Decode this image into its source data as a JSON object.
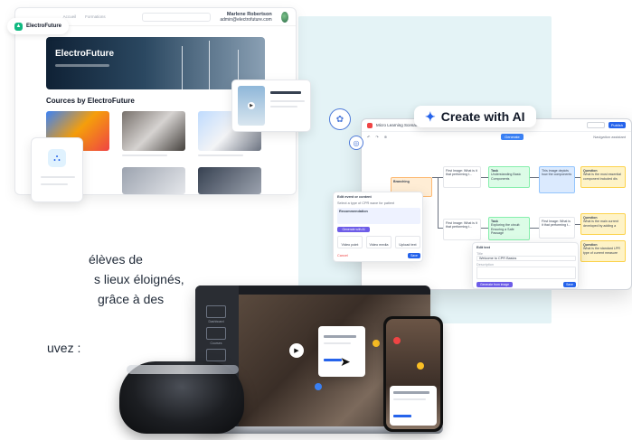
{
  "left_dashboard": {
    "brand": "ElectroFuture",
    "nav": [
      "Accueil",
      "Formations"
    ],
    "user_name": "Marlene Robertson",
    "user_email": "admin@electrofuture.com",
    "hero_title": "ElectroFuture",
    "section_title": "Cources by ElectroFuture"
  },
  "body_text": {
    "line1": "élèves de",
    "line2": "s lieux éloignés,",
    "line3": "grâce à des",
    "line4": "uvez :"
  },
  "ai_pill": {
    "label": "Create with AI",
    "icon": "sparkle-icon"
  },
  "ai_window": {
    "title": "Micro Learning Scenario",
    "toolbar_button": "Generate",
    "top_right": "Navigation assistant",
    "publish_label": "Publish",
    "nodes": {
      "branching": "Branching",
      "text1": "First Image: What is it that performing t...",
      "task1": "Task",
      "task1_body": "Understanding Basic Components",
      "image_text": "This image depicts how the components",
      "question1": "Question",
      "question1_body": "What is the most essential component included dis",
      "text2": "First Image: What is it that performing t...",
      "task2": "Task",
      "task2_body": "Exploring the circuit: Ensuring a Safe Passage",
      "text3": "First Image: What is it that performing t...",
      "question2": "Question",
      "question2_body": "What is the main current developed by adding a",
      "question3": "Question",
      "question3_body": "What is the standard LPR type of current measure"
    },
    "edit_panel_left": {
      "title": "Edit event or content",
      "desc": "Select a type of CPR wave for patient",
      "recommendation": "Recommendation",
      "action": "Generate with AI",
      "button1": "Video point",
      "button2": "Video media",
      "button3": "Upload text",
      "cancel": "Cancel",
      "save": "Save"
    },
    "edit_panel_right": {
      "title": "Edit text",
      "title_label": "Title",
      "title_value": "Welcome to CPR Basics",
      "desc_label": "Description",
      "ai_button": "Generate from image",
      "save": "Save"
    }
  },
  "laptop": {
    "sidebar_items": [
      "Dashboard",
      "Courses",
      "Users"
    ]
  },
  "colors": {
    "accent": "#2563eb",
    "brand_green": "#10b981",
    "teal_bg": "#e4f3f6"
  }
}
